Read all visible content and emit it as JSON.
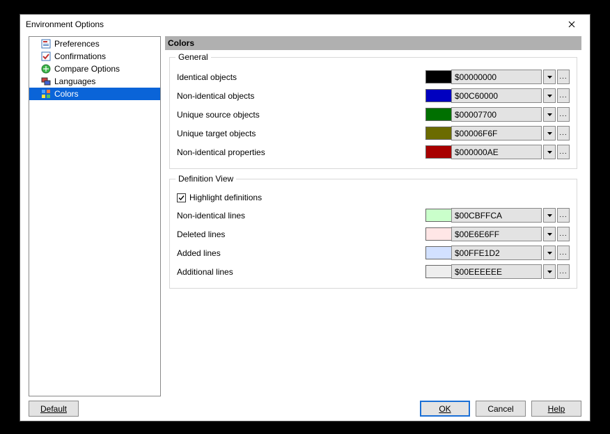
{
  "window": {
    "title": "Environment Options"
  },
  "tree": {
    "items": [
      {
        "label": "Preferences",
        "icon": "preferences"
      },
      {
        "label": "Confirmations",
        "icon": "confirmations"
      },
      {
        "label": "Compare Options",
        "icon": "compare"
      },
      {
        "label": "Languages",
        "icon": "languages"
      },
      {
        "label": "Colors",
        "icon": "colors",
        "selected": true
      }
    ]
  },
  "panel": {
    "title": "Colors",
    "general": {
      "title": "General",
      "rows": [
        {
          "label": "Identical objects",
          "swatch": "#000000",
          "value": "$00000000"
        },
        {
          "label": "Non-identical objects",
          "swatch": "#0000c0",
          "value": "$00C60000"
        },
        {
          "label": "Unique source objects",
          "swatch": "#007000",
          "value": "$00007700"
        },
        {
          "label": "Unique target objects",
          "swatch": "#6b6b00",
          "value": "$00006F6F"
        },
        {
          "label": "Non-identical properties",
          "swatch": "#a80000",
          "value": "$000000AE"
        }
      ]
    },
    "defview": {
      "title": "Definition View",
      "checkbox": {
        "label": "Highlight definitions",
        "checked": true
      },
      "rows": [
        {
          "label": "Non-identical lines",
          "swatch": "#caffcb",
          "value": "$00CBFFCA"
        },
        {
          "label": "Deleted lines",
          "swatch": "#ffe6e6",
          "value": "$00E6E6FF"
        },
        {
          "label": "Added lines",
          "swatch": "#d2e1ff",
          "value": "$00FFE1D2"
        },
        {
          "label": "Additional lines",
          "swatch": "#eeeeee",
          "value": "$00EEEEEE"
        }
      ]
    }
  },
  "buttons": {
    "default": "Default",
    "ok": "OK",
    "cancel": "Cancel",
    "help": "Help"
  }
}
